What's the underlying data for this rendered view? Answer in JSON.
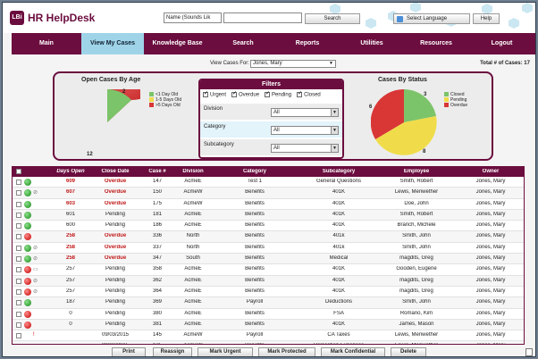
{
  "header": {
    "logo": "LBi",
    "title": "HR HelpDesk",
    "search_type": "Name (Sounds Lik",
    "search_value": "",
    "search_label": "Search",
    "language_label": "Select Language",
    "help_label": "Help"
  },
  "nav": [
    "Main",
    "View My Cases",
    "Knowledge Base",
    "Search",
    "Reports",
    "Utilities",
    "Resources",
    "Logout"
  ],
  "view_cases": {
    "label": "View Cases For:",
    "value": "Jones, Mary"
  },
  "total_cases": "Total # of Cases: 17",
  "charts": {
    "age": {
      "title": "Open Cases By Age",
      "legend": [
        "<1 Day Old",
        "1-5 Days Old",
        ">5 Days Old"
      ],
      "labels": [
        "2",
        "12"
      ],
      "colors": [
        "#7cc46a",
        "#f0dc4a",
        "#d93636"
      ]
    },
    "status": {
      "title": "Cases By Status",
      "legend": [
        "Closed",
        "Pending",
        "Overdue"
      ],
      "labels": [
        "6",
        "3",
        "8"
      ],
      "colors": [
        "#7cc46a",
        "#f0dc4a",
        "#d93636"
      ]
    }
  },
  "filters": {
    "title": "Filters",
    "checks": [
      {
        "label": "Urgent",
        "checked": true
      },
      {
        "label": "Overdue",
        "checked": true
      },
      {
        "label": "Pending",
        "checked": true
      },
      {
        "label": "Closed",
        "checked": true
      }
    ],
    "division": {
      "label": "Division",
      "value": "All"
    },
    "category": {
      "label": "Category",
      "value": "All"
    },
    "subcategory": {
      "label": "Subcategory",
      "value": "All"
    }
  },
  "table": {
    "headers": [
      "Days Open",
      "Close Date",
      "Case #",
      "Division",
      "Category",
      "Subcategory",
      "Employee",
      "Owner"
    ],
    "rows": [
      {
        "dot": "green",
        "flag": "",
        "days": "609",
        "close": "Overdue",
        "case": "147",
        "div": "AcmeE",
        "cat": "Test 1",
        "sub": "General Questions",
        "emp": "Smith, Robert",
        "owner": "Jones, Mary"
      },
      {
        "dot": "green",
        "flag": "clip",
        "days": "607",
        "close": "Overdue",
        "case": "150",
        "div": "AcmeW",
        "cat": "Benefits",
        "sub": "401K",
        "emp": "Lewis, Meriwether",
        "owner": "Jones, Mary"
      },
      {
        "dot": "green",
        "flag": "",
        "days": "603",
        "close": "Overdue",
        "case": "175",
        "div": "AcmeW",
        "cat": "Benefits",
        "sub": "401K",
        "emp": "Doe, John",
        "owner": "Jones, Mary"
      },
      {
        "dot": "green",
        "flag": "",
        "days": "601",
        "close": "Pending",
        "case": "181",
        "div": "AcmeE",
        "cat": "Benefits",
        "sub": "401K",
        "emp": "Smith, Robert",
        "owner": "Jones, Mary"
      },
      {
        "dot": "green",
        "flag": "",
        "days": "600",
        "close": "Pending",
        "case": "186",
        "div": "AcmeE",
        "cat": "Benefits",
        "sub": "401K",
        "emp": "Branch, Michele",
        "owner": "Jones, Mary"
      },
      {
        "dot": "red",
        "flag": "",
        "days": "258",
        "close": "Overdue",
        "case": "336",
        "div": "North",
        "cat": "Benefits",
        "sub": "401k",
        "emp": "Smith, John",
        "owner": "Jones, Mary"
      },
      {
        "dot": "green",
        "flag": "clip",
        "days": "258",
        "close": "Overdue",
        "case": "337",
        "div": "North",
        "cat": "Benefits",
        "sub": "401k",
        "emp": "Smith, John",
        "owner": "Jones, Mary"
      },
      {
        "dot": "green",
        "flag": "clip",
        "days": "258",
        "close": "Overdue",
        "case": "347",
        "div": "South",
        "cat": "Benefits",
        "sub": "Medical",
        "emp": "magdits, Greg",
        "owner": "Jones, Mary"
      },
      {
        "dot": "red",
        "flag": "note",
        "days": "257",
        "close": "Pending",
        "case": "358",
        "div": "AcmeE",
        "cat": "Benefits",
        "sub": "401K",
        "emp": "Gooden, Eugene",
        "owner": "Jones, Mary"
      },
      {
        "dot": "red",
        "flag": "clip",
        "days": "257",
        "close": "Pending",
        "case": "362",
        "div": "AcmeE",
        "cat": "Benefits",
        "sub": "401K",
        "emp": "magdits, Greg",
        "owner": "Jones, Mary"
      },
      {
        "dot": "red",
        "flag": "clip",
        "days": "257",
        "close": "Pending",
        "case": "364",
        "div": "AcmeE",
        "cat": "Benefits",
        "sub": "401K",
        "emp": "magdits, Greg",
        "owner": "Jones, Mary"
      },
      {
        "dot": "green",
        "flag": "",
        "days": "187",
        "close": "Pending",
        "case": "369",
        "div": "AcmeE",
        "cat": "Payroll",
        "sub": "Deductions",
        "emp": "Smith, John",
        "owner": "Jones, Mary"
      },
      {
        "dot": "red",
        "flag": "",
        "days": "0",
        "close": "Pending",
        "case": "380",
        "div": "AcmeE",
        "cat": "Benefits",
        "sub": "FSA",
        "emp": "Romano, Kim",
        "owner": "Jones, Mary"
      },
      {
        "dot": "red",
        "flag": "",
        "days": "0",
        "close": "Pending",
        "case": "381",
        "div": "AcmeE",
        "cat": "Benefits",
        "sub": "401K",
        "emp": "James, Mason",
        "owner": "Jones, Mary"
      },
      {
        "dot": "",
        "flag": "excl",
        "days": "",
        "close": "09/03/2015",
        "case": "145",
        "div": "AcmeW",
        "cat": "Payroll",
        "sub": "CA Taxes",
        "emp": "Lewis, Meriwether",
        "owner": "Jones, Mary"
      },
      {
        "dot": "",
        "flag": "",
        "days": "",
        "close": "09/03/2015",
        "case": "135",
        "div": "AcmeW",
        "cat": "Benefits",
        "sub": "Relocation Expenses",
        "emp": "Lewis, Meriwether",
        "owner": "Jones, Mary"
      },
      {
        "dot": "red",
        "flag": "excl",
        "days": "",
        "close": "09/03/2015",
        "case": "137",
        "div": "AcmeW",
        "cat": "Benefits",
        "sub": "Relocation Expenses",
        "emp": "Lewis, Meriwether",
        "owner": "Jones, Mary"
      }
    ]
  },
  "buttons": [
    "Print",
    "Reassign",
    "Mark Urgent",
    "Mark Protected",
    "Mark Confidential",
    "Delete"
  ]
}
